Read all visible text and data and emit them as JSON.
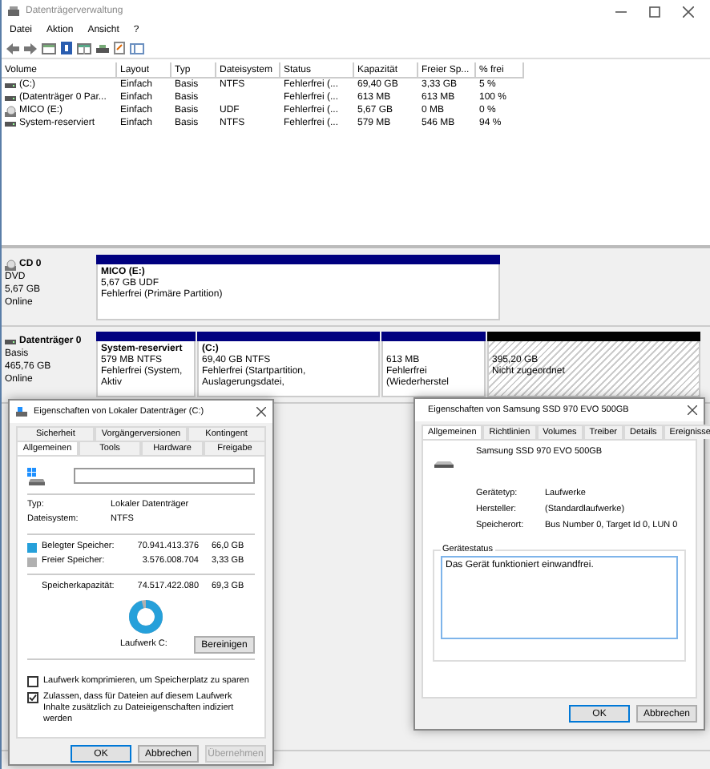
{
  "window": {
    "title": "Datenträgerverwaltung"
  },
  "menu": [
    "Datei",
    "Aktion",
    "Ansicht",
    "?"
  ],
  "volumes": {
    "columns": [
      "Volume",
      "Layout",
      "Typ",
      "Dateisystem",
      "Status",
      "Kapazität",
      "Freier Sp...",
      "% frei"
    ],
    "rows": [
      {
        "kind": "disk",
        "volume": "(C:)",
        "layout": "Einfach",
        "type": "Basis",
        "filesystem": "NTFS",
        "status": "Fehlerfrei (...",
        "capacity": "69,40 GB",
        "free": "3,33 GB",
        "free_percent": "5 %"
      },
      {
        "kind": "disk",
        "volume": "(Datenträger 0 Par...",
        "layout": "Einfach",
        "type": "Basis",
        "status": "Fehlerfrei (...",
        "capacity": "613 MB",
        "free": "613 MB",
        "free_percent": "100 %"
      },
      {
        "kind": "cdrom",
        "volume": "MICO (E:)",
        "layout": "Einfach",
        "type": "Basis",
        "filesystem": "UDF",
        "status": "Fehlerfrei (...",
        "capacity": "5,67 GB",
        "free": "0 MB",
        "free_percent": "0 %"
      },
      {
        "kind": "disk",
        "volume": "System-reserviert",
        "layout": "Einfach",
        "type": "Basis",
        "filesystem": "NTFS",
        "status": "Fehlerfrei (...",
        "capacity": "579 MB",
        "free": "546 MB",
        "free_percent": "94 %"
      }
    ]
  },
  "disks": [
    {
      "kind": "cdrom",
      "name": "CD 0",
      "lines": [
        "DVD",
        "5,67 GB",
        "Online"
      ],
      "partitions": [
        {
          "kind": "primary",
          "title": "MICO  (E:)",
          "size": "5,67 GB UDF",
          "status": "Fehlerfrei (Primäre Partition)"
        }
      ]
    },
    {
      "kind": "disk",
      "name": "Datenträger 0",
      "lines": [
        "Basis",
        "465,76 GB",
        "Online"
      ],
      "partitions": [
        {
          "kind": "primary",
          "title": "System-reserviert",
          "size": "579 MB NTFS",
          "status": "Fehlerfrei (System, Aktiv"
        },
        {
          "kind": "primary",
          "title": "(C:)",
          "size": "69,40 GB NTFS",
          "status": "Fehlerfrei (Startpartition, Auslagerungsdatei,"
        },
        {
          "kind": "primary",
          "size": "613 MB",
          "status": "Fehlerfrei (Wiederherstel"
        },
        {
          "kind": "unallocated",
          "size": "395,20 GB",
          "status": "Nicht zugeordnet"
        }
      ]
    }
  ],
  "drive_dialog": {
    "title": "Eigenschaften von Lokaler Datenträger (C:)",
    "tab_rows": [
      {
        "tabs": [
          {
            "label": "Sicherheit",
            "selected": false
          },
          {
            "label": "Vorgängerversionen",
            "selected": false
          },
          {
            "label": "Kontingent",
            "selected": false
          }
        ]
      },
      {
        "tabs": [
          {
            "label": "Allgemeinen",
            "selected": true
          },
          {
            "label": "Tools",
            "selected": false
          },
          {
            "label": "Hardware",
            "selected": false
          },
          {
            "label": "Freigabe",
            "selected": false
          }
        ]
      }
    ],
    "info": [
      {
        "label": "Typ:",
        "value": "Lokaler Datenträger"
      },
      {
        "label": "Dateisystem:",
        "value": "NTFS"
      }
    ],
    "usage": [
      {
        "label": "Belegter Speicher:",
        "bytes": "70.941.413.376",
        "size": "66,0 GB",
        "color": "#26a0da"
      },
      {
        "label": "Freier Speicher:",
        "bytes": "3.576.008.704",
        "size": "3,33 GB",
        "color": "#b0b0b0"
      }
    ],
    "capacity": {
      "label": "Speicherkapazität:",
      "bytes": "74.517.422.080",
      "size": "69,3 GB"
    },
    "donut": {
      "caption": "Laufwerk C:"
    },
    "cleanup_button": "Bereinigen",
    "options": [
      {
        "label": "Laufwerk komprimieren, um Speicherplatz zu sparen",
        "checked": false
      },
      {
        "label": "Zulassen, dass für Dateien auf diesem Laufwerk Inhalte zusätzlich zu Dateieigenschaften indiziert werden",
        "checked": true
      }
    ],
    "buttons": [
      {
        "label": "OK",
        "disabled": false
      },
      {
        "label": "Abbrechen",
        "disabled": false
      },
      {
        "label": "Übernehmen",
        "disabled": true
      }
    ]
  },
  "device_dialog": {
    "title": "Eigenschaften von Samsung SSD 970 EVO 500GB",
    "tabs": [
      {
        "label": "Allgemeinen",
        "selected": true
      },
      {
        "label": "Richtlinien",
        "selected": false
      },
      {
        "label": "Volumes",
        "selected": false
      },
      {
        "label": "Treiber",
        "selected": false
      },
      {
        "label": "Details",
        "selected": false
      },
      {
        "label": "Ereignisse",
        "selected": false
      }
    ],
    "device_name": "Samsung SSD 970 EVO 500GB",
    "properties": [
      {
        "label": "Gerätetyp:",
        "value": "Laufwerke"
      },
      {
        "label": "Hersteller:",
        "value": "(Standardlaufwerke)"
      },
      {
        "label": "Speicherort:",
        "value": "Bus Number 0, Target Id 0, LUN 0"
      }
    ],
    "status_group": "Gerätestatus",
    "status_text": "Das Gerät funktioniert einwandfrei.",
    "buttons": [
      {
        "label": "OK",
        "disabled": false
      },
      {
        "label": "Abbrechen",
        "disabled": false
      }
    ]
  }
}
